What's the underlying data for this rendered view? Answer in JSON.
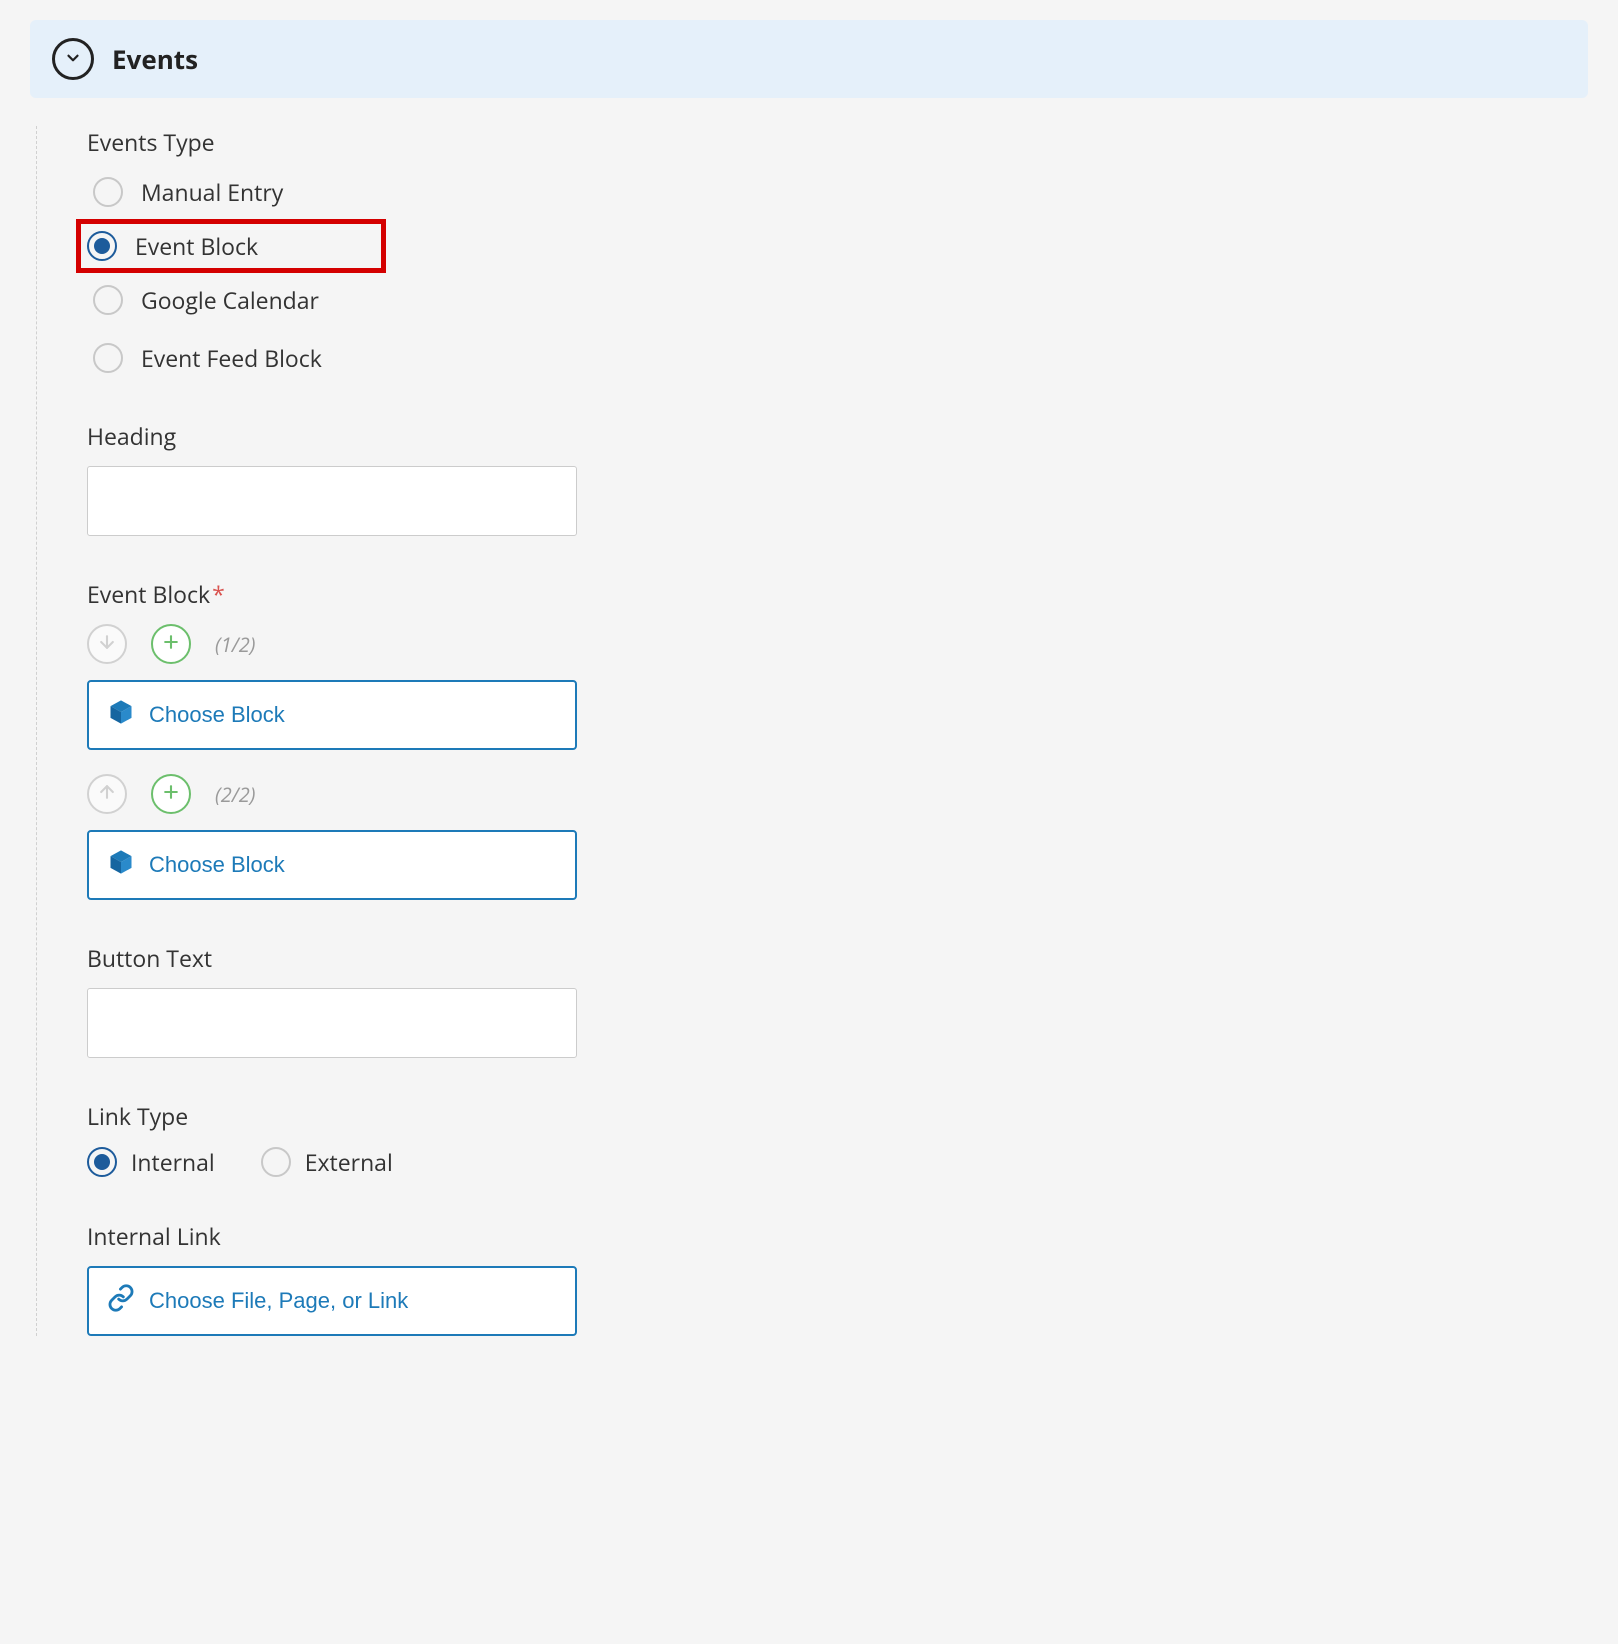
{
  "panel": {
    "title": "Events"
  },
  "events_type": {
    "label": "Events Type",
    "options": [
      {
        "label": "Manual Entry",
        "selected": false
      },
      {
        "label": "Event Block",
        "selected": true,
        "highlighted": true
      },
      {
        "label": "Google Calendar",
        "selected": false
      },
      {
        "label": "Event Feed Block",
        "selected": false
      }
    ]
  },
  "heading": {
    "label": "Heading",
    "value": ""
  },
  "event_block": {
    "label": "Event Block",
    "required": true,
    "items": [
      {
        "counter": "(1/2)",
        "choose_label": "Choose Block",
        "move_up": false,
        "move_down": true
      },
      {
        "counter": "(2/2)",
        "choose_label": "Choose Block",
        "move_up": true,
        "move_down": false
      }
    ]
  },
  "button_text": {
    "label": "Button Text",
    "value": ""
  },
  "link_type": {
    "label": "Link Type",
    "options": [
      {
        "label": "Internal",
        "selected": true
      },
      {
        "label": "External",
        "selected": false
      }
    ]
  },
  "internal_link": {
    "label": "Internal Link",
    "choose_label": "Choose File, Page, or Link"
  }
}
